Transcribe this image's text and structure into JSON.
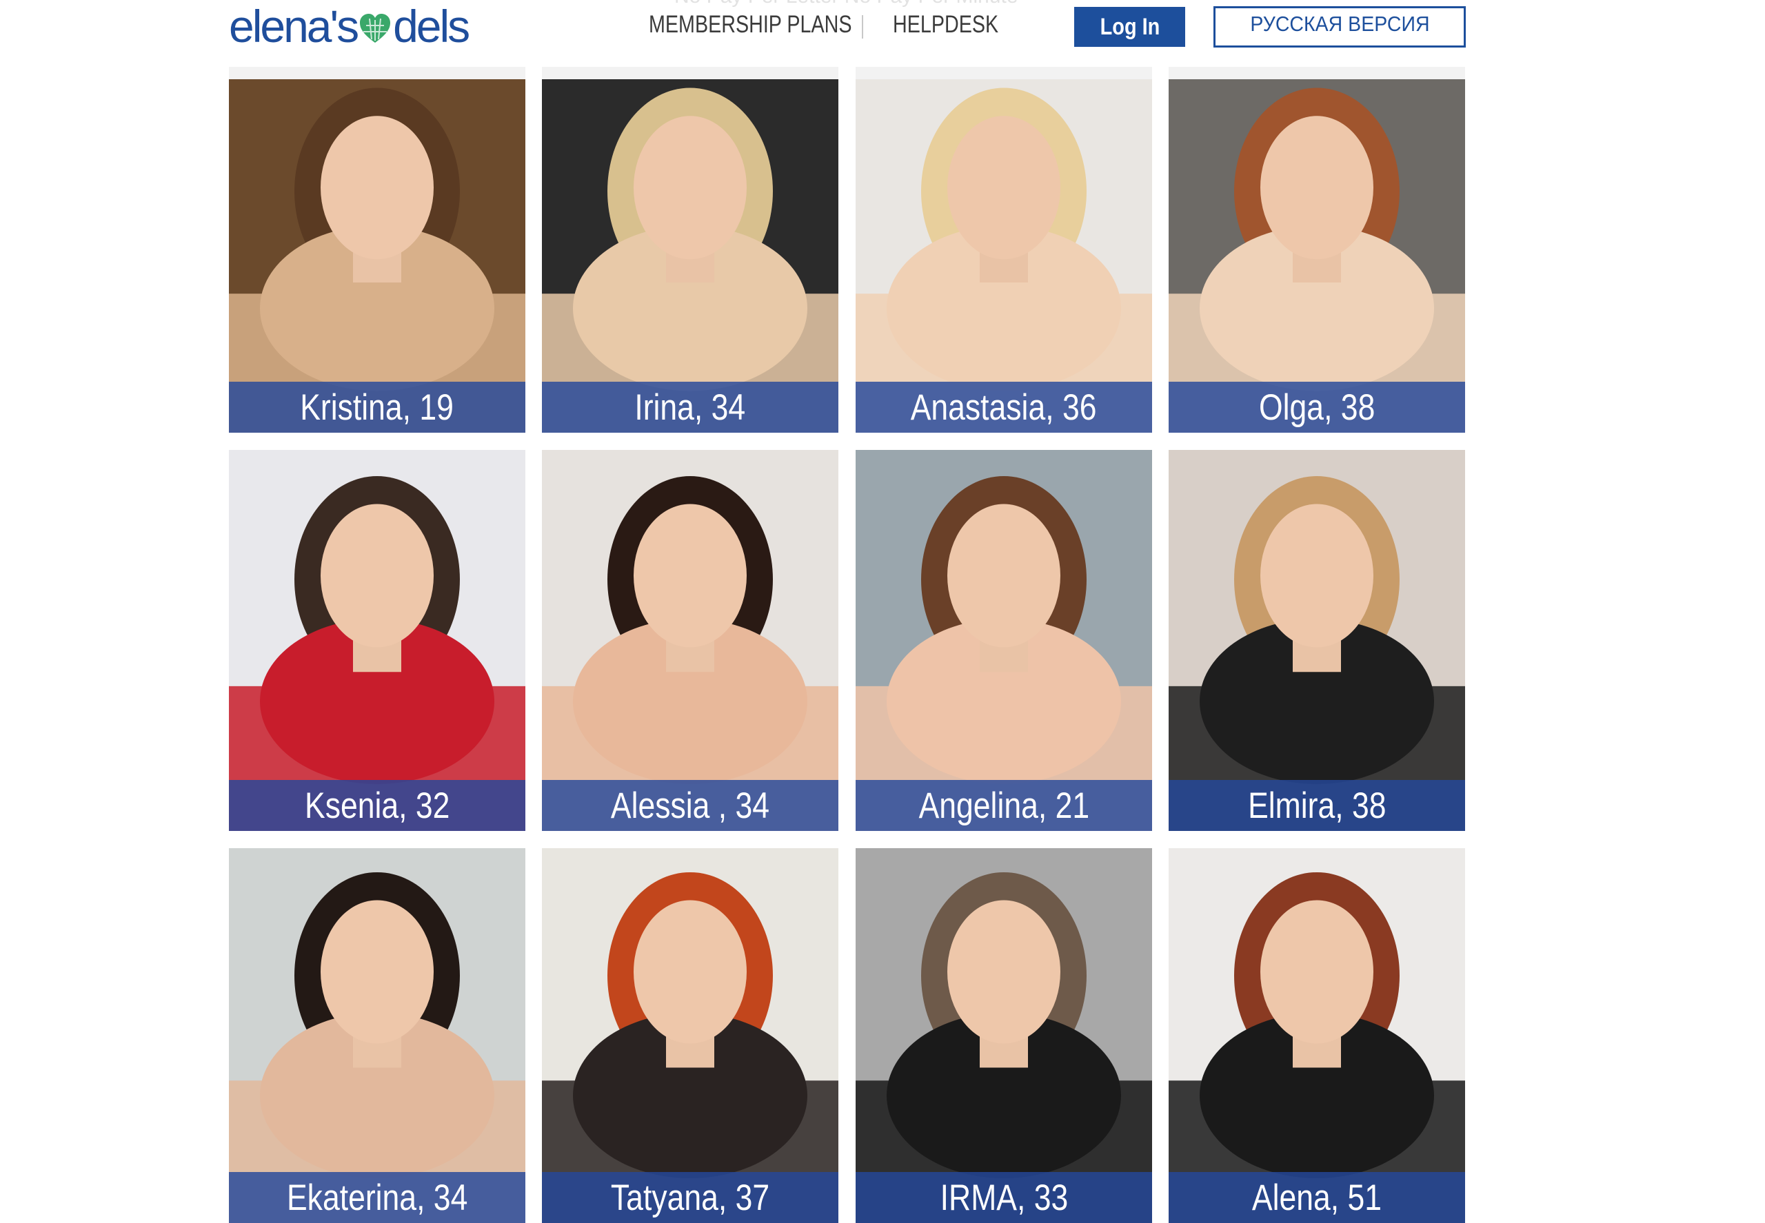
{
  "header": {
    "logo_text_left": "elena's",
    "logo_text_right": "dels",
    "tagline": "No Pay Per Letter   No Pay Per Minute",
    "nav": [
      "MEMBERSHIP PLANS",
      "HELPDESK"
    ],
    "login_label": "Log In",
    "russian_label": "РУССКАЯ ВЕРСИЯ"
  },
  "colors": {
    "brand_blue": "#1d4f9c",
    "label_overlay": "#24489b",
    "logo_heart": "#3aa86a"
  },
  "profiles": [
    {
      "name_age": "Kristina, 19",
      "bg": "#6b4a2c",
      "accent": "#d8b08a",
      "hair": "#5a3a22"
    },
    {
      "name_age": "Irina, 34",
      "bg": "#2b2b2b",
      "accent": "#e8c9a8",
      "hair": "#d8c08e"
    },
    {
      "name_age": "Anastasia, 36",
      "bg": "#e9e6e2",
      "accent": "#f0d0b4",
      "hair": "#e8cf9c"
    },
    {
      "name_age": "Olga, 38",
      "bg": "#6d6a66",
      "accent": "#efd2b8",
      "hair": "#a0552e"
    },
    {
      "name_age": "Ksenia, 32",
      "bg": "#e8e8ec",
      "accent": "#c81d2c",
      "hair": "#3a2a22"
    },
    {
      "name_age": "Alessia , 34",
      "bg": "#e6e2de",
      "accent": "#e8b89a",
      "hair": "#2a1a14"
    },
    {
      "name_age": "Angelina, 21",
      "bg": "#9aa6ad",
      "accent": "#eec3a8",
      "hair": "#6a4028"
    },
    {
      "name_age": "Elmira, 38",
      "bg": "#d8cfc8",
      "accent": "#1e1e1e",
      "hair": "#c89c6a"
    },
    {
      "name_age": "Ekaterina, 34",
      "bg": "#cfd3d2",
      "accent": "#e2b89c",
      "hair": "#231915"
    },
    {
      "name_age": "Tatyana, 37",
      "bg": "#e8e6e0",
      "accent": "#2a2322",
      "hair": "#c2461c"
    },
    {
      "name_age": "IRMA, 33",
      "bg": "#a8a8a8",
      "accent": "#1a1a1a",
      "hair": "#6e5a4a"
    },
    {
      "name_age": "Alena, 51",
      "bg": "#eceae8",
      "accent": "#1a1a1a",
      "hair": "#8a3a22"
    }
  ]
}
